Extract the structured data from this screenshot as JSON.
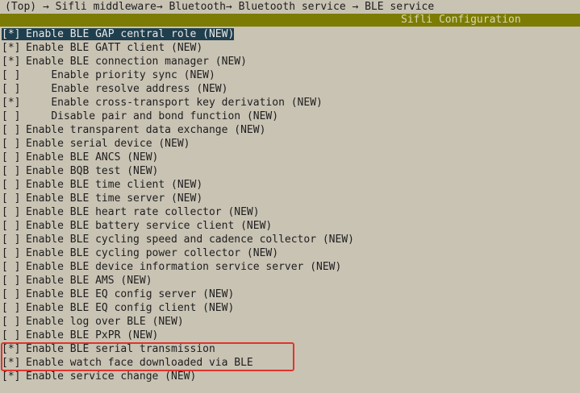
{
  "breadcrumb": "(Top) → Sifli middleware→ Bluetooth→ Bluetooth service → BLE service",
  "title": "Sifli Configuration",
  "items": [
    {
      "checkbox": "[*]",
      "label": "Enable BLE GAP central role (NEW)",
      "indent": 0,
      "selected": true
    },
    {
      "checkbox": "[*]",
      "label": "Enable BLE GATT client (NEW)",
      "indent": 0
    },
    {
      "checkbox": "[*]",
      "label": "Enable BLE connection manager (NEW)",
      "indent": 0
    },
    {
      "checkbox": "[ ]",
      "label": "Enable priority sync (NEW)",
      "indent": 1
    },
    {
      "checkbox": "[ ]",
      "label": "Enable resolve address (NEW)",
      "indent": 1
    },
    {
      "checkbox": "[*]",
      "label": "Enable cross-transport key derivation (NEW)",
      "indent": 1
    },
    {
      "checkbox": "[ ]",
      "label": "Disable pair and bond function (NEW)",
      "indent": 1
    },
    {
      "checkbox": "[ ]",
      "label": "Enable transparent data exchange (NEW)",
      "indent": 0
    },
    {
      "checkbox": "[ ]",
      "label": "Enable serial device (NEW)",
      "indent": 0
    },
    {
      "checkbox": "[ ]",
      "label": "Enable BLE ANCS (NEW)",
      "indent": 0
    },
    {
      "checkbox": "[ ]",
      "label": "Enable BQB test (NEW)",
      "indent": 0
    },
    {
      "checkbox": "[ ]",
      "label": "Enable BLE time client (NEW)",
      "indent": 0
    },
    {
      "checkbox": "[ ]",
      "label": "Enable BLE time server (NEW)",
      "indent": 0
    },
    {
      "checkbox": "[ ]",
      "label": "Enable BLE heart rate collector (NEW)",
      "indent": 0
    },
    {
      "checkbox": "[ ]",
      "label": "Enable BLE battery service client (NEW)",
      "indent": 0
    },
    {
      "checkbox": "[ ]",
      "label": "Enable BLE cycling speed and cadence collector (NEW)",
      "indent": 0
    },
    {
      "checkbox": "[ ]",
      "label": "Enable BLE cycling power collector (NEW)",
      "indent": 0
    },
    {
      "checkbox": "[ ]",
      "label": "Enable BLE device information service server (NEW)",
      "indent": 0
    },
    {
      "checkbox": "[ ]",
      "label": "Enable BLE AMS (NEW)",
      "indent": 0
    },
    {
      "checkbox": "[ ]",
      "label": "Enable BLE EQ config server (NEW)",
      "indent": 0
    },
    {
      "checkbox": "[ ]",
      "label": "Enable BLE EQ config client (NEW)",
      "indent": 0
    },
    {
      "checkbox": "[ ]",
      "label": "Enable log over BLE (NEW)",
      "indent": 0
    },
    {
      "checkbox": "[ ]",
      "label": "Enable BLE PxPR (NEW)",
      "indent": 0
    },
    {
      "checkbox": "[*]",
      "label": "Enable BLE serial transmission",
      "indent": 0
    },
    {
      "checkbox": "[*]",
      "label": "Enable watch face downloaded via BLE",
      "indent": 0
    },
    {
      "checkbox": "[*]",
      "label": "Enable service change (NEW)",
      "indent": 0
    }
  ],
  "colors": {
    "background": "#c9c3b4",
    "title_bar": "#7c7c04",
    "selection": "#1f3f4e",
    "highlight_box": "#e0342c"
  }
}
